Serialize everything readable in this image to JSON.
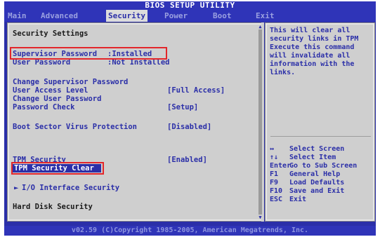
{
  "window": {
    "title": "BIOS SETUP UTILITY",
    "footer": "v02.59 (C)Copyright 1985-2005, American Megatrends, Inc."
  },
  "tabs": [
    {
      "label": "Main",
      "active": false
    },
    {
      "label": "Advanced",
      "active": false
    },
    {
      "label": "Security",
      "active": true
    },
    {
      "label": "Power",
      "active": false
    },
    {
      "label": "Boot",
      "active": false
    },
    {
      "label": "Exit",
      "active": false
    }
  ],
  "security": {
    "section_title": "Security Settings",
    "supervisor_password_label": "Supervisor Password",
    "supervisor_password_value": ":Installed",
    "user_password_label": "User Password",
    "user_password_value": ":Not Installed",
    "items": [
      {
        "label": "Change Supervisor Password",
        "value": ""
      },
      {
        "label": "User Access Level",
        "value": "[Full Access]"
      },
      {
        "label": "Change User Password",
        "value": ""
      },
      {
        "label": "Password Check",
        "value": "[Setup]"
      },
      {
        "label": "Boot Sector Virus Protection",
        "value": "[Disabled]"
      },
      {
        "label": "TPM Security",
        "value": "[Enabled]"
      },
      {
        "label": "TPM Security Clear",
        "value": ""
      },
      {
        "label": "I/O Interface Security",
        "value": "",
        "arrow": "►"
      },
      {
        "label": "Hard Disk Security",
        "value": ""
      }
    ]
  },
  "help": {
    "text": "This will clear all\nsecurity links in TPM\nExecute this command\nwill invalidate all\ninformation with the\nlinks."
  },
  "keys": [
    {
      "key": "↔",
      "desc": "Select Screen"
    },
    {
      "key": "↑↓",
      "desc": "Select Item"
    },
    {
      "key": "Enter",
      "desc": "Go to Sub Screen"
    },
    {
      "key": "F1",
      "desc": "General Help"
    },
    {
      "key": "F9",
      "desc": "Load Defaults"
    },
    {
      "key": "F10",
      "desc": "Save and Exit"
    },
    {
      "key": "ESC",
      "desc": "Exit"
    }
  ],
  "colors": {
    "background_blue": "#2b2fa8",
    "panel_gray": "#cfcfcf",
    "highlight_red": "#e3262a"
  }
}
